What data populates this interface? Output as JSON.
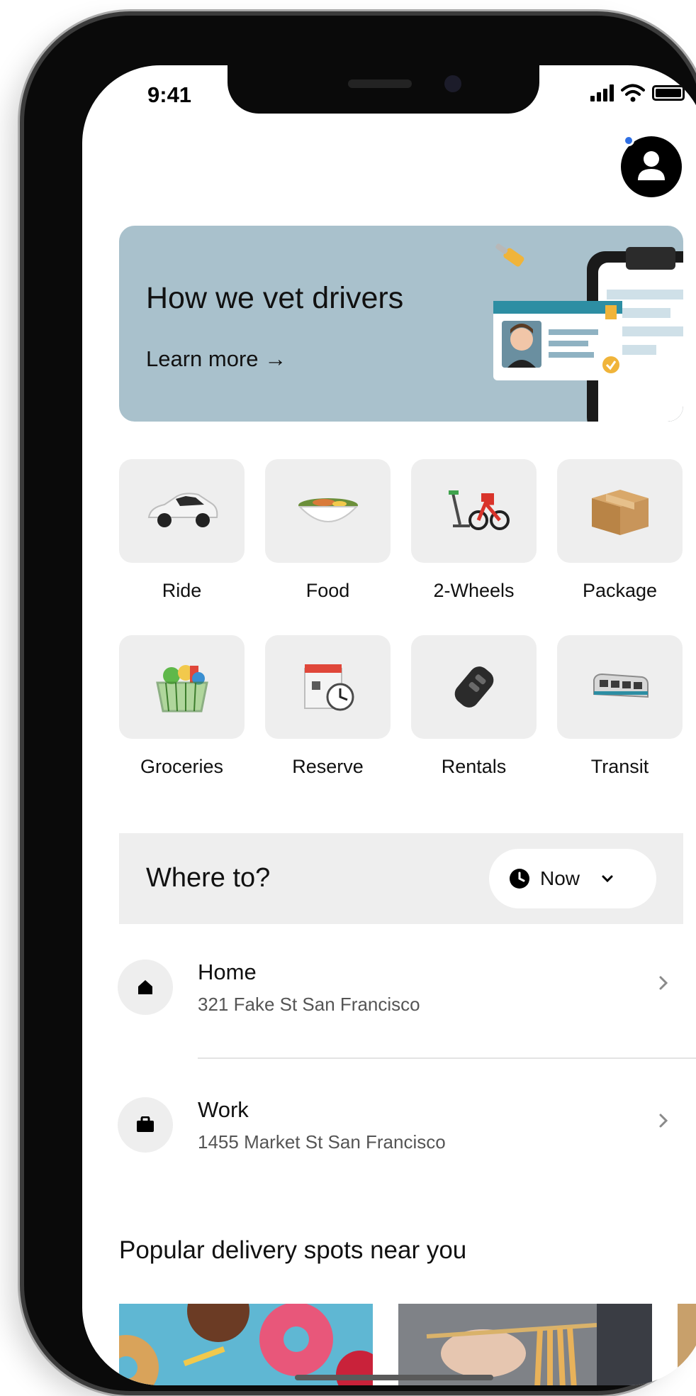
{
  "status_bar": {
    "time": "9:41"
  },
  "promo": {
    "title": "How we vet drivers",
    "link_label": "Learn more →"
  },
  "services": [
    {
      "label": "Ride",
      "icon": "car-icon"
    },
    {
      "label": "Food",
      "icon": "food-bowl-icon"
    },
    {
      "label": "2-Wheels",
      "icon": "bike-scooter-icon"
    },
    {
      "label": "Package",
      "icon": "package-box-icon"
    },
    {
      "label": "Groceries",
      "icon": "grocery-basket-icon"
    },
    {
      "label": "Reserve",
      "icon": "calendar-clock-icon"
    },
    {
      "label": "Rentals",
      "icon": "car-key-icon"
    },
    {
      "label": "Transit",
      "icon": "train-icon"
    }
  ],
  "where_to": {
    "placeholder": "Where to?",
    "time_option": "Now"
  },
  "saved_places": [
    {
      "name": "Home",
      "address": "321 Fake St San Francisco",
      "icon": "home-icon"
    },
    {
      "name": "Work",
      "address": "1455 Market St San Francisco",
      "icon": "briefcase-icon"
    }
  ],
  "popular": {
    "title": "Popular delivery spots near you"
  },
  "colors": {
    "promo_bg": "#a9c1cc",
    "tile_bg": "#eeeeee",
    "notification_dot": "#2f6fe4"
  }
}
